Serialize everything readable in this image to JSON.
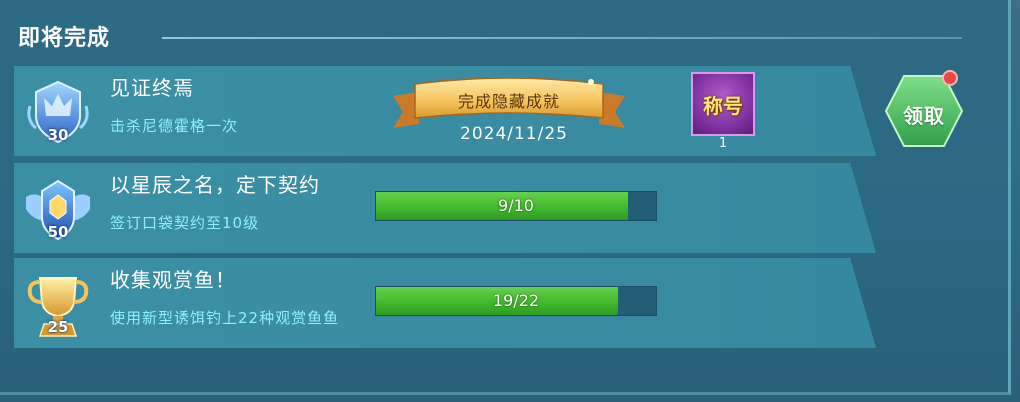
{
  "section": {
    "title": "即将完成"
  },
  "achievements": [
    {
      "badge_level": "30",
      "badge_icon": "blue-crown-badge-icon",
      "title": "见证终焉",
      "description": "击杀尼德霍格一次",
      "status": "完成隐藏成就",
      "date": "2024/11/25",
      "reward": {
        "label": "称号",
        "count": "1"
      }
    },
    {
      "badge_level": "50",
      "badge_icon": "blue-winged-badge-icon",
      "title": "以星辰之名，定下契约",
      "description": "签订口袋契约至10级",
      "progress": {
        "text": "9/10",
        "value": 0.9
      }
    },
    {
      "badge_level": "25",
      "badge_icon": "gold-trophy-badge-icon",
      "title": "收集观赏鱼！",
      "description": "使用新型诱饵钓上22种观赏鱼鱼",
      "progress": {
        "text": "19/22",
        "value": 0.8636
      }
    }
  ],
  "claim_button": {
    "label": "领取",
    "has_notification": true
  },
  "colors": {
    "progress_fill": "#3fb52c",
    "desc_text": "#8ef0ff",
    "notification": "#e84848"
  }
}
